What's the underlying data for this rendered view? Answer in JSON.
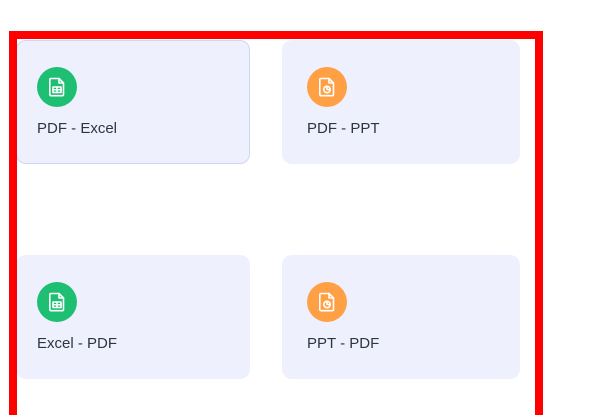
{
  "tools": [
    {
      "label": "PDF - Excel",
      "icon": "spreadsheet-file-icon",
      "color": "#1fbf73"
    },
    {
      "label": "PDF - PPT",
      "icon": "presentation-file-icon",
      "color": "#ffa044"
    },
    {
      "label": "Excel - PDF",
      "icon": "spreadsheet-file-icon",
      "color": "#1fbf73"
    },
    {
      "label": "PPT - PDF",
      "icon": "presentation-file-icon",
      "color": "#ffa044"
    }
  ],
  "highlight_color": "#ff0000"
}
